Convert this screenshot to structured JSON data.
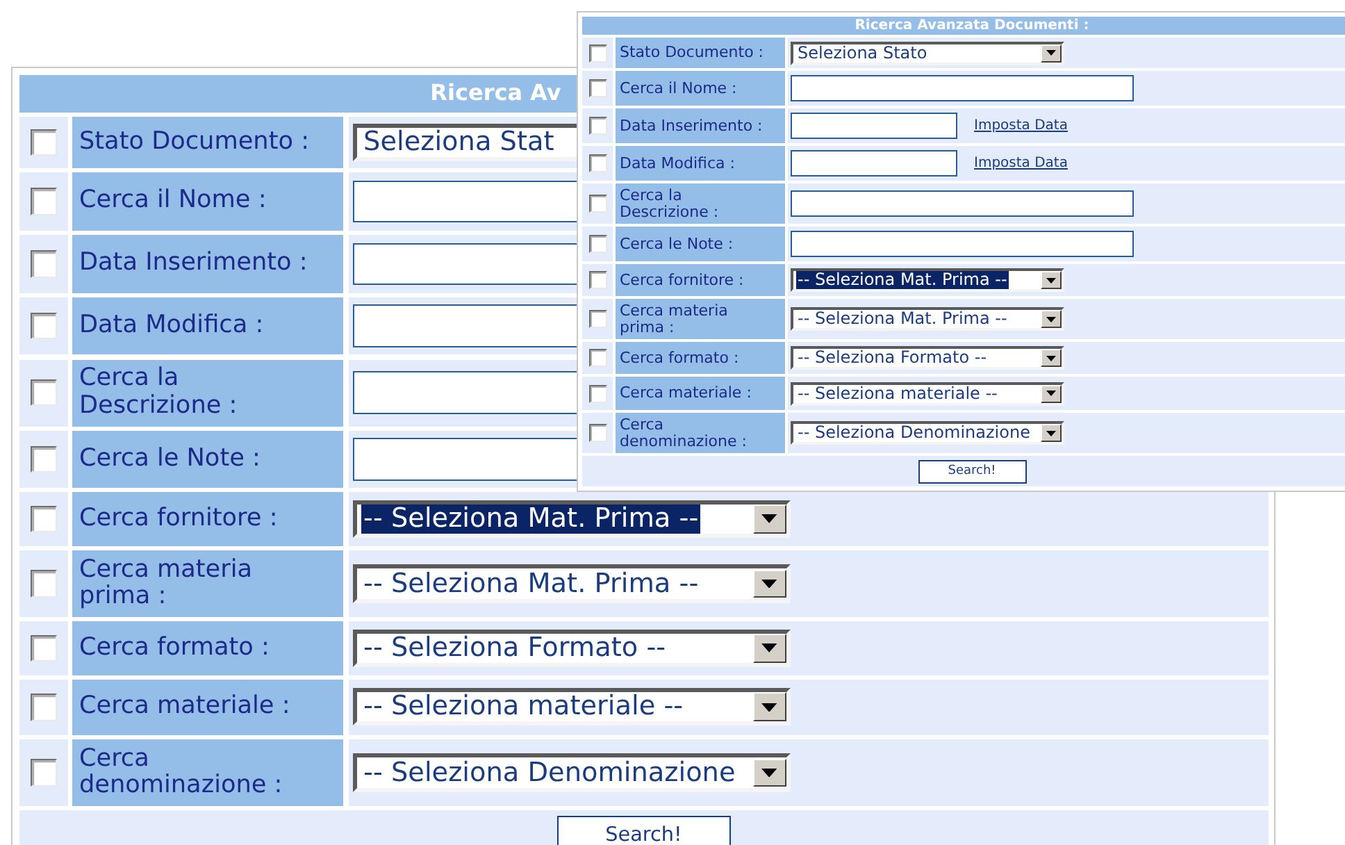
{
  "forms": [
    {
      "title": "Ricerca Av",
      "rows": [
        {
          "kind": "select",
          "label": "Stato Documento :",
          "checked": false,
          "value": "Seleziona Stat",
          "highlighted": false
        },
        {
          "kind": "text",
          "label": "Cerca il Nome :",
          "checked": false
        },
        {
          "kind": "date",
          "label": "Data Inserimento :",
          "checked": false
        },
        {
          "kind": "date",
          "label": "Data Modifica :",
          "checked": false
        },
        {
          "kind": "text",
          "label": "Cerca la Descrizione :",
          "checked": false
        },
        {
          "kind": "text",
          "label": "Cerca le Note :",
          "checked": false
        },
        {
          "kind": "select",
          "label": "Cerca fornitore :",
          "checked": false,
          "value": "-- Seleziona Mat. Prima --",
          "highlighted": true
        },
        {
          "kind": "select",
          "label": "Cerca materia prima :",
          "checked": false,
          "value": "-- Seleziona Mat. Prima --",
          "highlighted": false
        },
        {
          "kind": "select",
          "label": "Cerca formato :",
          "checked": false,
          "value": "-- Seleziona Formato --",
          "highlighted": false
        },
        {
          "kind": "select",
          "label": "Cerca materiale :",
          "checked": false,
          "value": "-- Seleziona materiale --",
          "highlighted": false
        },
        {
          "kind": "select",
          "label": "Cerca denominazione :",
          "checked": false,
          "value": "-- Seleziona Denominazione",
          "highlighted": false
        }
      ],
      "button": "Search!"
    },
    {
      "title": "Ricerca Avanzata Documenti :",
      "rows": [
        {
          "kind": "select",
          "label": "Stato Documento :",
          "checked": false,
          "value": "Seleziona Stato",
          "highlighted": false
        },
        {
          "kind": "text",
          "label": "Cerca il Nome :",
          "checked": false
        },
        {
          "kind": "date",
          "label": "Data Inserimento :",
          "checked": false,
          "link": "Imposta Data"
        },
        {
          "kind": "date",
          "label": "Data Modifica :",
          "checked": false,
          "link": "Imposta Data"
        },
        {
          "kind": "text",
          "label": "Cerca la Descrizione :",
          "checked": false
        },
        {
          "kind": "text",
          "label": "Cerca le Note :",
          "checked": false
        },
        {
          "kind": "select",
          "label": "Cerca fornitore :",
          "checked": false,
          "value": "-- Seleziona Mat. Prima --",
          "highlighted": true
        },
        {
          "kind": "select",
          "label": "Cerca materia prima :",
          "checked": false,
          "value": "-- Seleziona Mat. Prima --",
          "highlighted": false
        },
        {
          "kind": "select",
          "label": "Cerca formato :",
          "checked": false,
          "value": "-- Seleziona Formato --",
          "highlighted": false
        },
        {
          "kind": "select",
          "label": "Cerca materiale :",
          "checked": false,
          "value": "-- Seleziona materiale --",
          "highlighted": false
        },
        {
          "kind": "select",
          "label": "Cerca denominazione :",
          "checked": false,
          "value": "-- Seleziona Denominazione",
          "highlighted": false
        }
      ],
      "button": "Search!"
    }
  ]
}
